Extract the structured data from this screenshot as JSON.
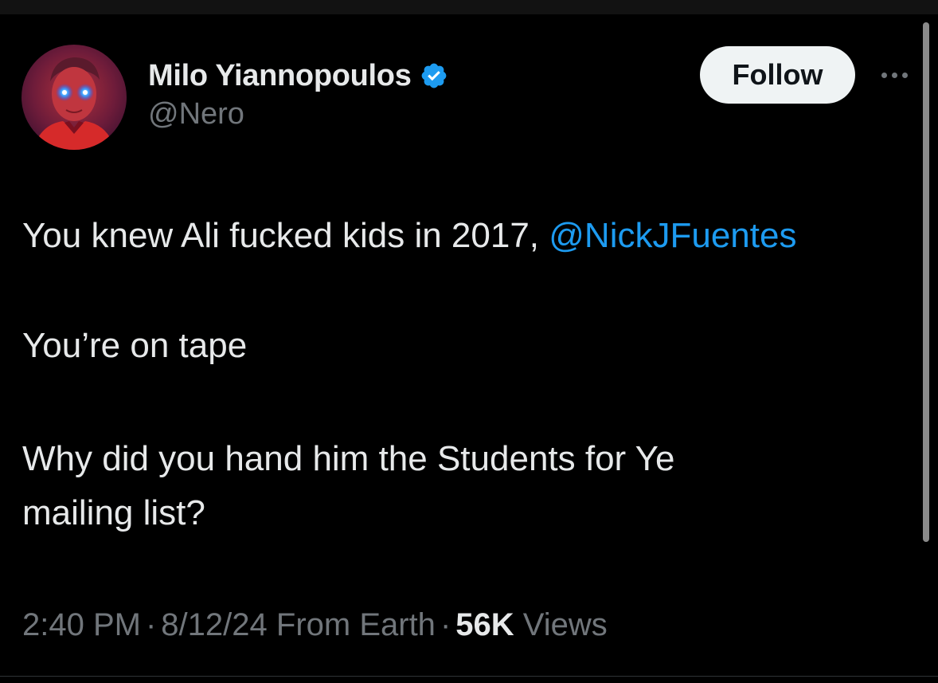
{
  "author": {
    "display_name": "Milo Yiannopoulos",
    "handle": "@Nero",
    "verified": true,
    "avatar_icon": "profile-photo-red-glowing-eyes"
  },
  "actions": {
    "follow_label": "Follow",
    "more_icon": "more-horizontal-icon"
  },
  "tweet": {
    "line1_text": "You knew Ali fucked kids in 2017, ",
    "line1_mention": "@NickJFuentes",
    "line2_text": "You’re on tape",
    "line3_text": "Why did you hand him the Students for Ye",
    "line4_text": "mailing list?"
  },
  "meta": {
    "time": "2:40 PM",
    "separator": "·",
    "date": "8/12/24",
    "source": "From Earth",
    "views_count": "56K",
    "views_label": "Views"
  },
  "colors": {
    "background": "#000000",
    "text_primary": "#e7e9ea",
    "text_secondary": "#71767b",
    "accent": "#1d9bf0",
    "follow_button_bg": "#eff3f4"
  }
}
